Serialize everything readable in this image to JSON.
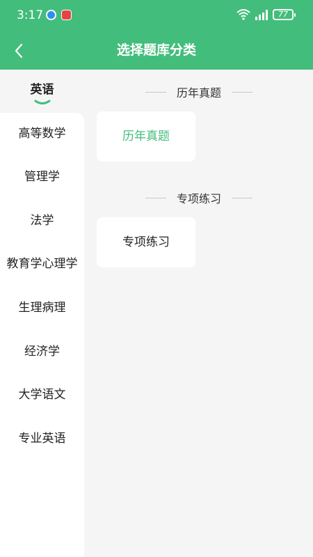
{
  "status_bar": {
    "time": "3:17",
    "battery": "77"
  },
  "header": {
    "title": "选择题库分类"
  },
  "sidebar": {
    "active": "英语",
    "items": [
      "高等数学",
      "管理学",
      "法学",
      "教育学心理学",
      "生理病理",
      "经济学",
      "大学语文",
      "专业英语"
    ]
  },
  "content": {
    "sections": [
      {
        "title": "历年真题",
        "cards": [
          "历年真题"
        ]
      },
      {
        "title": "专项练习",
        "cards": [
          "专项练习"
        ]
      }
    ]
  },
  "colors": {
    "accent": "#43bd7b",
    "background": "#f5f5f5"
  }
}
